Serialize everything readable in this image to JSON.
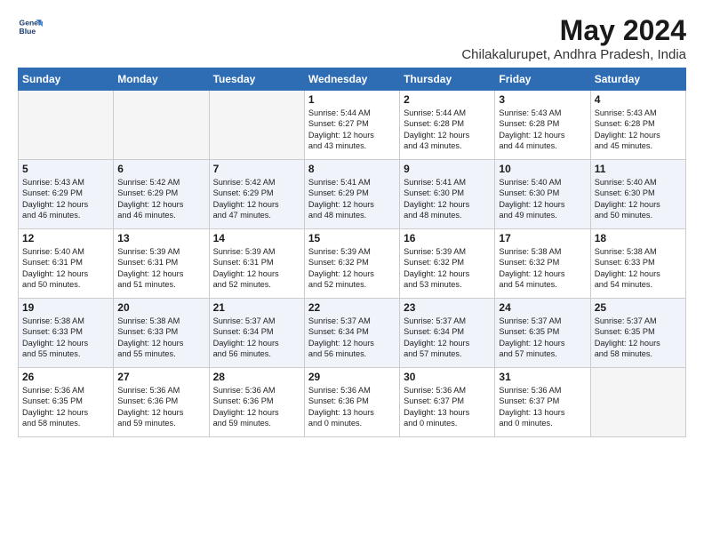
{
  "logo": {
    "line1": "General",
    "line2": "Blue"
  },
  "title": "May 2024",
  "subtitle": "Chilakalurupet, Andhra Pradesh, India",
  "days_header": [
    "Sunday",
    "Monday",
    "Tuesday",
    "Wednesday",
    "Thursday",
    "Friday",
    "Saturday"
  ],
  "weeks": [
    [
      {
        "num": "",
        "info": ""
      },
      {
        "num": "",
        "info": ""
      },
      {
        "num": "",
        "info": ""
      },
      {
        "num": "1",
        "info": "Sunrise: 5:44 AM\nSunset: 6:27 PM\nDaylight: 12 hours\nand 43 minutes."
      },
      {
        "num": "2",
        "info": "Sunrise: 5:44 AM\nSunset: 6:28 PM\nDaylight: 12 hours\nand 43 minutes."
      },
      {
        "num": "3",
        "info": "Sunrise: 5:43 AM\nSunset: 6:28 PM\nDaylight: 12 hours\nand 44 minutes."
      },
      {
        "num": "4",
        "info": "Sunrise: 5:43 AM\nSunset: 6:28 PM\nDaylight: 12 hours\nand 45 minutes."
      }
    ],
    [
      {
        "num": "5",
        "info": "Sunrise: 5:43 AM\nSunset: 6:29 PM\nDaylight: 12 hours\nand 46 minutes."
      },
      {
        "num": "6",
        "info": "Sunrise: 5:42 AM\nSunset: 6:29 PM\nDaylight: 12 hours\nand 46 minutes."
      },
      {
        "num": "7",
        "info": "Sunrise: 5:42 AM\nSunset: 6:29 PM\nDaylight: 12 hours\nand 47 minutes."
      },
      {
        "num": "8",
        "info": "Sunrise: 5:41 AM\nSunset: 6:29 PM\nDaylight: 12 hours\nand 48 minutes."
      },
      {
        "num": "9",
        "info": "Sunrise: 5:41 AM\nSunset: 6:30 PM\nDaylight: 12 hours\nand 48 minutes."
      },
      {
        "num": "10",
        "info": "Sunrise: 5:40 AM\nSunset: 6:30 PM\nDaylight: 12 hours\nand 49 minutes."
      },
      {
        "num": "11",
        "info": "Sunrise: 5:40 AM\nSunset: 6:30 PM\nDaylight: 12 hours\nand 50 minutes."
      }
    ],
    [
      {
        "num": "12",
        "info": "Sunrise: 5:40 AM\nSunset: 6:31 PM\nDaylight: 12 hours\nand 50 minutes."
      },
      {
        "num": "13",
        "info": "Sunrise: 5:39 AM\nSunset: 6:31 PM\nDaylight: 12 hours\nand 51 minutes."
      },
      {
        "num": "14",
        "info": "Sunrise: 5:39 AM\nSunset: 6:31 PM\nDaylight: 12 hours\nand 52 minutes."
      },
      {
        "num": "15",
        "info": "Sunrise: 5:39 AM\nSunset: 6:32 PM\nDaylight: 12 hours\nand 52 minutes."
      },
      {
        "num": "16",
        "info": "Sunrise: 5:39 AM\nSunset: 6:32 PM\nDaylight: 12 hours\nand 53 minutes."
      },
      {
        "num": "17",
        "info": "Sunrise: 5:38 AM\nSunset: 6:32 PM\nDaylight: 12 hours\nand 54 minutes."
      },
      {
        "num": "18",
        "info": "Sunrise: 5:38 AM\nSunset: 6:33 PM\nDaylight: 12 hours\nand 54 minutes."
      }
    ],
    [
      {
        "num": "19",
        "info": "Sunrise: 5:38 AM\nSunset: 6:33 PM\nDaylight: 12 hours\nand 55 minutes."
      },
      {
        "num": "20",
        "info": "Sunrise: 5:38 AM\nSunset: 6:33 PM\nDaylight: 12 hours\nand 55 minutes."
      },
      {
        "num": "21",
        "info": "Sunrise: 5:37 AM\nSunset: 6:34 PM\nDaylight: 12 hours\nand 56 minutes."
      },
      {
        "num": "22",
        "info": "Sunrise: 5:37 AM\nSunset: 6:34 PM\nDaylight: 12 hours\nand 56 minutes."
      },
      {
        "num": "23",
        "info": "Sunrise: 5:37 AM\nSunset: 6:34 PM\nDaylight: 12 hours\nand 57 minutes."
      },
      {
        "num": "24",
        "info": "Sunrise: 5:37 AM\nSunset: 6:35 PM\nDaylight: 12 hours\nand 57 minutes."
      },
      {
        "num": "25",
        "info": "Sunrise: 5:37 AM\nSunset: 6:35 PM\nDaylight: 12 hours\nand 58 minutes."
      }
    ],
    [
      {
        "num": "26",
        "info": "Sunrise: 5:36 AM\nSunset: 6:35 PM\nDaylight: 12 hours\nand 58 minutes."
      },
      {
        "num": "27",
        "info": "Sunrise: 5:36 AM\nSunset: 6:36 PM\nDaylight: 12 hours\nand 59 minutes."
      },
      {
        "num": "28",
        "info": "Sunrise: 5:36 AM\nSunset: 6:36 PM\nDaylight: 12 hours\nand 59 minutes."
      },
      {
        "num": "29",
        "info": "Sunrise: 5:36 AM\nSunset: 6:36 PM\nDaylight: 13 hours\nand 0 minutes."
      },
      {
        "num": "30",
        "info": "Sunrise: 5:36 AM\nSunset: 6:37 PM\nDaylight: 13 hours\nand 0 minutes."
      },
      {
        "num": "31",
        "info": "Sunrise: 5:36 AM\nSunset: 6:37 PM\nDaylight: 13 hours\nand 0 minutes."
      },
      {
        "num": "",
        "info": ""
      }
    ]
  ]
}
